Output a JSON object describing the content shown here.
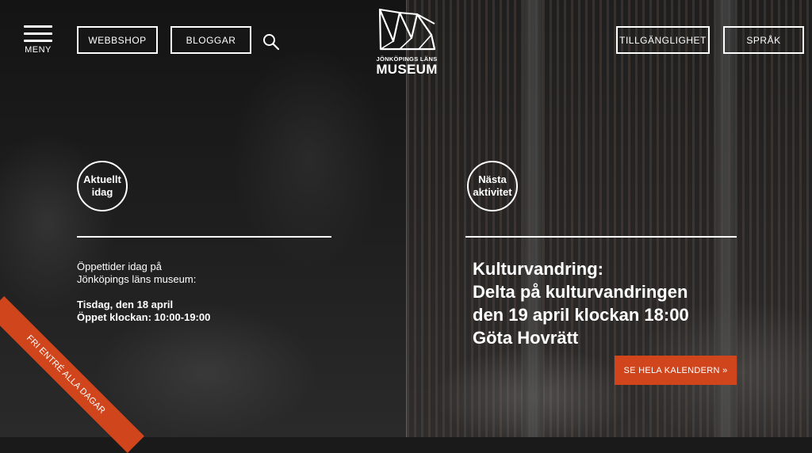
{
  "header": {
    "menu_label": "MENY",
    "nav_left": [
      "WEBBSHOP",
      "BLOGGAR"
    ],
    "nav_right": [
      "TILLGÄNGLIGHET",
      "SPRÅK"
    ],
    "logo": {
      "line1": "JÖNKÖPINGS LÄNS",
      "line2": "MUSEUM"
    }
  },
  "left_panel": {
    "badge": "Aktuellt idag",
    "intro": "Öppettider idag på Jönköpings läns museum:",
    "date_line": "Tisdag, den 18 april",
    "hours_line": "Öppet klockan: 10:00-19:00"
  },
  "right_panel": {
    "badge": "Nästa aktivitet",
    "event_lines": [
      "Kulturvandring:",
      "Delta på kulturvandringen",
      "den 19 april klockan 18:00",
      "Göta Hovrätt"
    ],
    "calendar_button": "SE HELA KALENDERN »"
  },
  "ribbon": "FRI ENTRÉ ALLA DAGAR",
  "colors": {
    "accent": "#d0451b",
    "text": "#ffffff",
    "background": "#1a1a1a"
  }
}
